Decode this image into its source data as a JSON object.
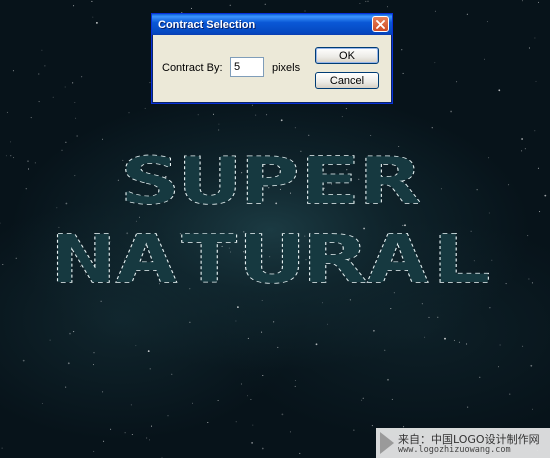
{
  "canvas": {
    "art_text_line1": "SUPER",
    "art_text_line2": "NATURAL",
    "background_color": "#07131a",
    "glow_color": "#1b3a42",
    "selection_color": "#e8f3f4"
  },
  "dialog": {
    "title": "Contract Selection",
    "field_label": "Contract By:",
    "field_value": "5",
    "unit": "pixels",
    "ok_label": "OK",
    "cancel_label": "Cancel",
    "titlebar_color": "#0a58d6",
    "close_button_color": "#cd4a24",
    "face_color": "#ece9d8"
  },
  "watermark": {
    "line1": "来自：中国LOGO设计制作网",
    "line2": "www.logozhizuowang.com"
  }
}
